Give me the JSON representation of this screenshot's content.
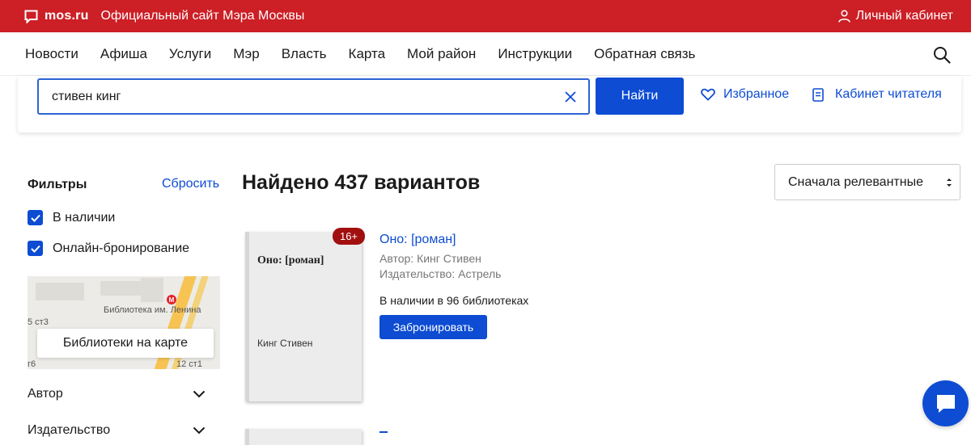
{
  "topbar": {
    "brand": "mos.ru",
    "subtitle": "Официальный сайт Мэра Москвы",
    "account_label": "Личный кабинет"
  },
  "nav": {
    "items": [
      "Новости",
      "Афиша",
      "Услуги",
      "Мэр",
      "Власть",
      "Карта",
      "Мой район",
      "Инструкции",
      "Обратная связь"
    ]
  },
  "search": {
    "value": "стивен кинг",
    "button_label": "Найти",
    "favorites_label": "Избранное",
    "reader_label": "Кабинет читателя"
  },
  "filters": {
    "title": "Фильтры",
    "reset_label": "Сбросить",
    "checkboxes": [
      {
        "label": "В наличии",
        "checked": true
      },
      {
        "label": "Онлайн-бронирование",
        "checked": true
      }
    ],
    "map": {
      "label": "Библиотека им. Ленина",
      "metro": "М",
      "street_1": "5 ст3",
      "street_2": "г6",
      "street_3": "12 ст1",
      "button_label": "Библиотеки на карте"
    },
    "sections": [
      "Автор",
      "Издательство"
    ]
  },
  "results": {
    "found_text": "Найдено 437 вариантов",
    "sort_value": "Сначала релевантные",
    "items": [
      {
        "age_badge": "16+",
        "cover_title": "Оно: [роман]",
        "cover_author": "Кинг Стивен",
        "title": "Оно: [роман]",
        "author": "Автор: Кинг Стивен",
        "publisher": "Издательство: Астрель",
        "availability": "В наличии в 96 библиотеках",
        "reserve_label": "Забронировать"
      }
    ]
  },
  "colors": {
    "brand_red": "#cc1f26",
    "accent_blue": "#0d4cd3",
    "badge_red": "#a1100f"
  }
}
